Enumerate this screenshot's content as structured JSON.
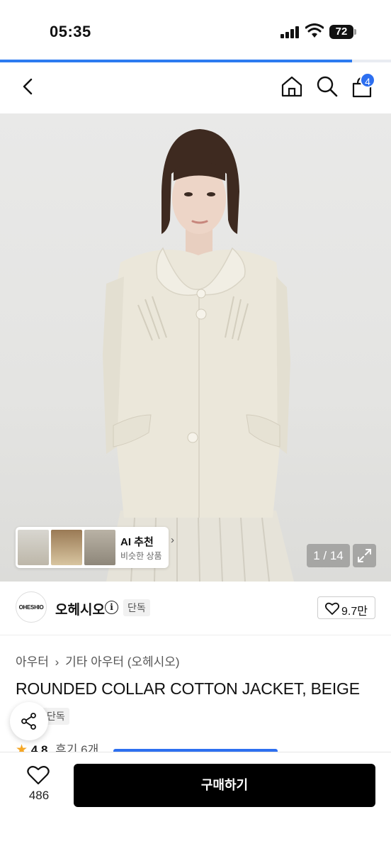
{
  "status_bar": {
    "time": "05:35",
    "battery": "72"
  },
  "progress": {
    "fraction": 0.9
  },
  "nav": {
    "cart_count": "4"
  },
  "gallery": {
    "ai_label": "AI 추천",
    "ai_sub": "비슷한 상품",
    "counter": "1 / 14"
  },
  "brand": {
    "logo_text": "OHESHIO",
    "name": "오헤시오",
    "tag": "단독",
    "likes": "9.7만"
  },
  "breadcrumb": {
    "level1": "아우터",
    "level2": "기타 아우터 (오헤시오)"
  },
  "product": {
    "title": "ROUNDED COLLAR COTTON JACKET, BEIGE",
    "exclusive_tag": "단독",
    "rating": "4.8",
    "reviews": "후기 6개"
  },
  "bottom_bar": {
    "like_count": "486",
    "buy_label": "구매하기"
  },
  "colors": {
    "accent": "#2d6ff0",
    "buy_button": "#000000",
    "star": "#f5a623"
  }
}
